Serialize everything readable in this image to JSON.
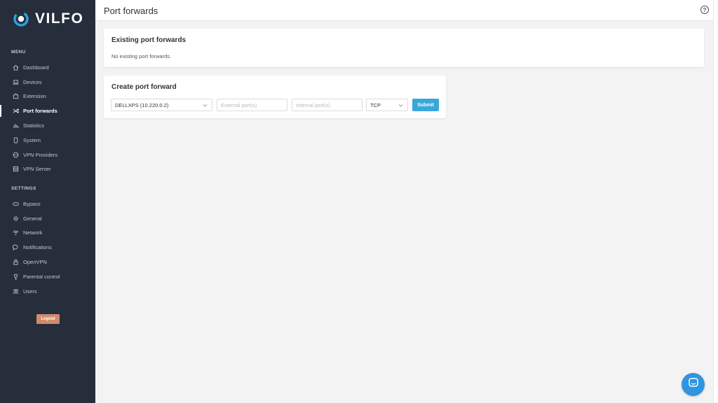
{
  "brand": {
    "name": "VILFO",
    "accent": "#2b9fe0"
  },
  "sidebar": {
    "menu_label": "MENU",
    "menu_items": [
      {
        "label": "Dashboard",
        "icon": "home-icon",
        "active": false
      },
      {
        "label": "Devices",
        "icon": "laptop-icon",
        "active": false
      },
      {
        "label": "Extension",
        "icon": "puzzle-icon",
        "active": false
      },
      {
        "label": "Port forwards",
        "icon": "shuffle-icon",
        "active": true
      },
      {
        "label": "Statistics",
        "icon": "bar-chart-icon",
        "active": false
      },
      {
        "label": "System",
        "icon": "tablet-icon",
        "active": false
      },
      {
        "label": "VPN Providers",
        "icon": "globe-icon",
        "active": false
      },
      {
        "label": "VPN Server",
        "icon": "server-icon",
        "active": false
      }
    ],
    "settings_label": "SETTINGS",
    "settings_items": [
      {
        "label": "Bypass",
        "icon": "link-icon"
      },
      {
        "label": "General",
        "icon": "gear-icon"
      },
      {
        "label": "Network",
        "icon": "wifi-icon"
      },
      {
        "label": "Notifications",
        "icon": "chat-bubble-icon"
      },
      {
        "label": "OpenVPN",
        "icon": "lock-icon"
      },
      {
        "label": "Parental control",
        "icon": "trophy-icon"
      },
      {
        "label": "Users",
        "icon": "users-icon"
      }
    ],
    "logout_label": "Logout",
    "logout_color": "#d08a6c"
  },
  "header": {
    "title": "Port forwards",
    "help_glyph": "?"
  },
  "existing": {
    "title": "Existing port forwards",
    "empty_text": "No existing port forwards."
  },
  "create": {
    "title": "Create port forward",
    "device_value": "DELLXPS (10.220.0.2)",
    "external_placeholder": "External port(s)",
    "internal_placeholder": "Internal port(s)",
    "protocol_value": "TCP",
    "submit_label": "Submit",
    "submit_color": "#3aa7da"
  }
}
